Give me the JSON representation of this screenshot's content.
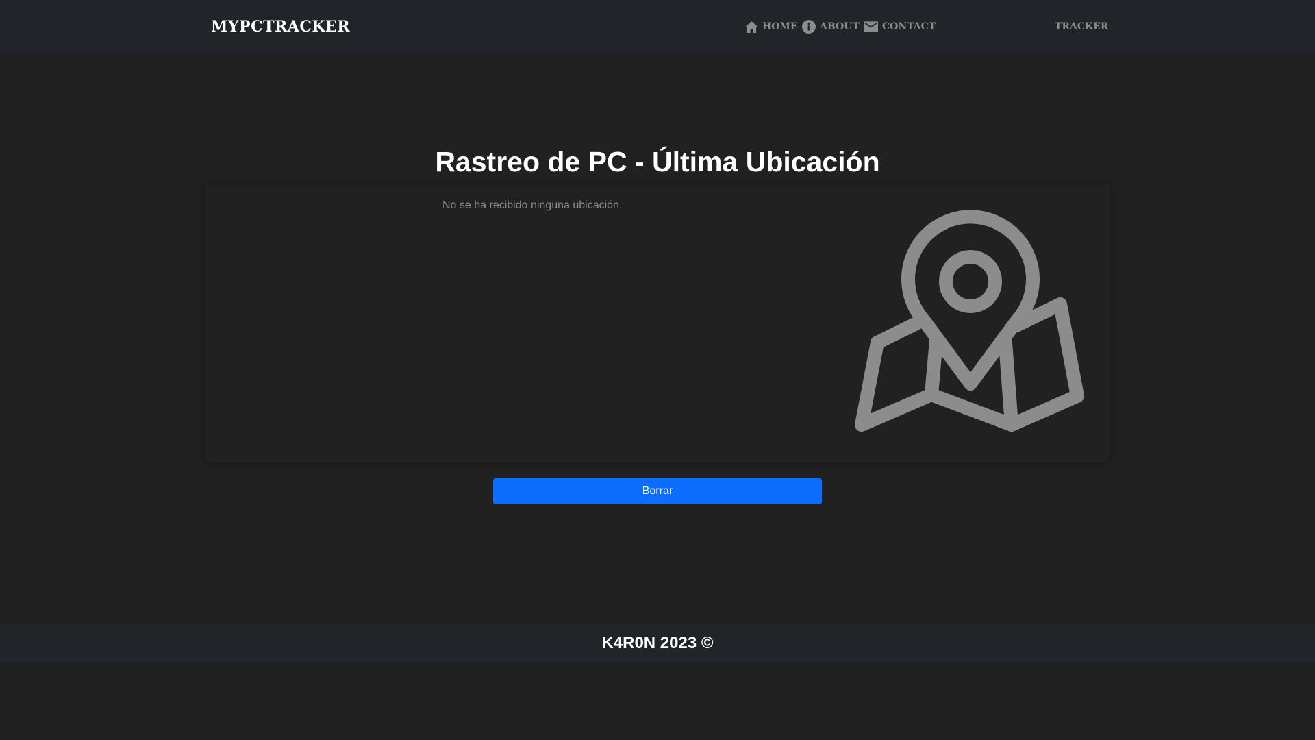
{
  "navbar": {
    "brand": "MyPcTracker",
    "links": [
      {
        "label": "Home",
        "icon": "home-icon"
      },
      {
        "label": "About",
        "icon": "info-icon"
      },
      {
        "label": "Contact",
        "icon": "mail-icon"
      }
    ],
    "tracker_label": "Tracker"
  },
  "main": {
    "title": "Rastreo de PC - Última Ubicación",
    "status_text": "No se ha recibido ninguna ubicación.",
    "illustration_icon": "map-location-pin-icon",
    "delete_button_label": "Borrar"
  },
  "footer": {
    "text": "K4R0N 2023 ©"
  },
  "colors": {
    "page_background": "#212121",
    "navbar_background": "#212529",
    "footer_background": "#212529",
    "nav_link": "#8c8c8c",
    "icon_gray": "#8c8c8c",
    "primary_button": "#0d6efd",
    "text_white": "#ffffff"
  }
}
